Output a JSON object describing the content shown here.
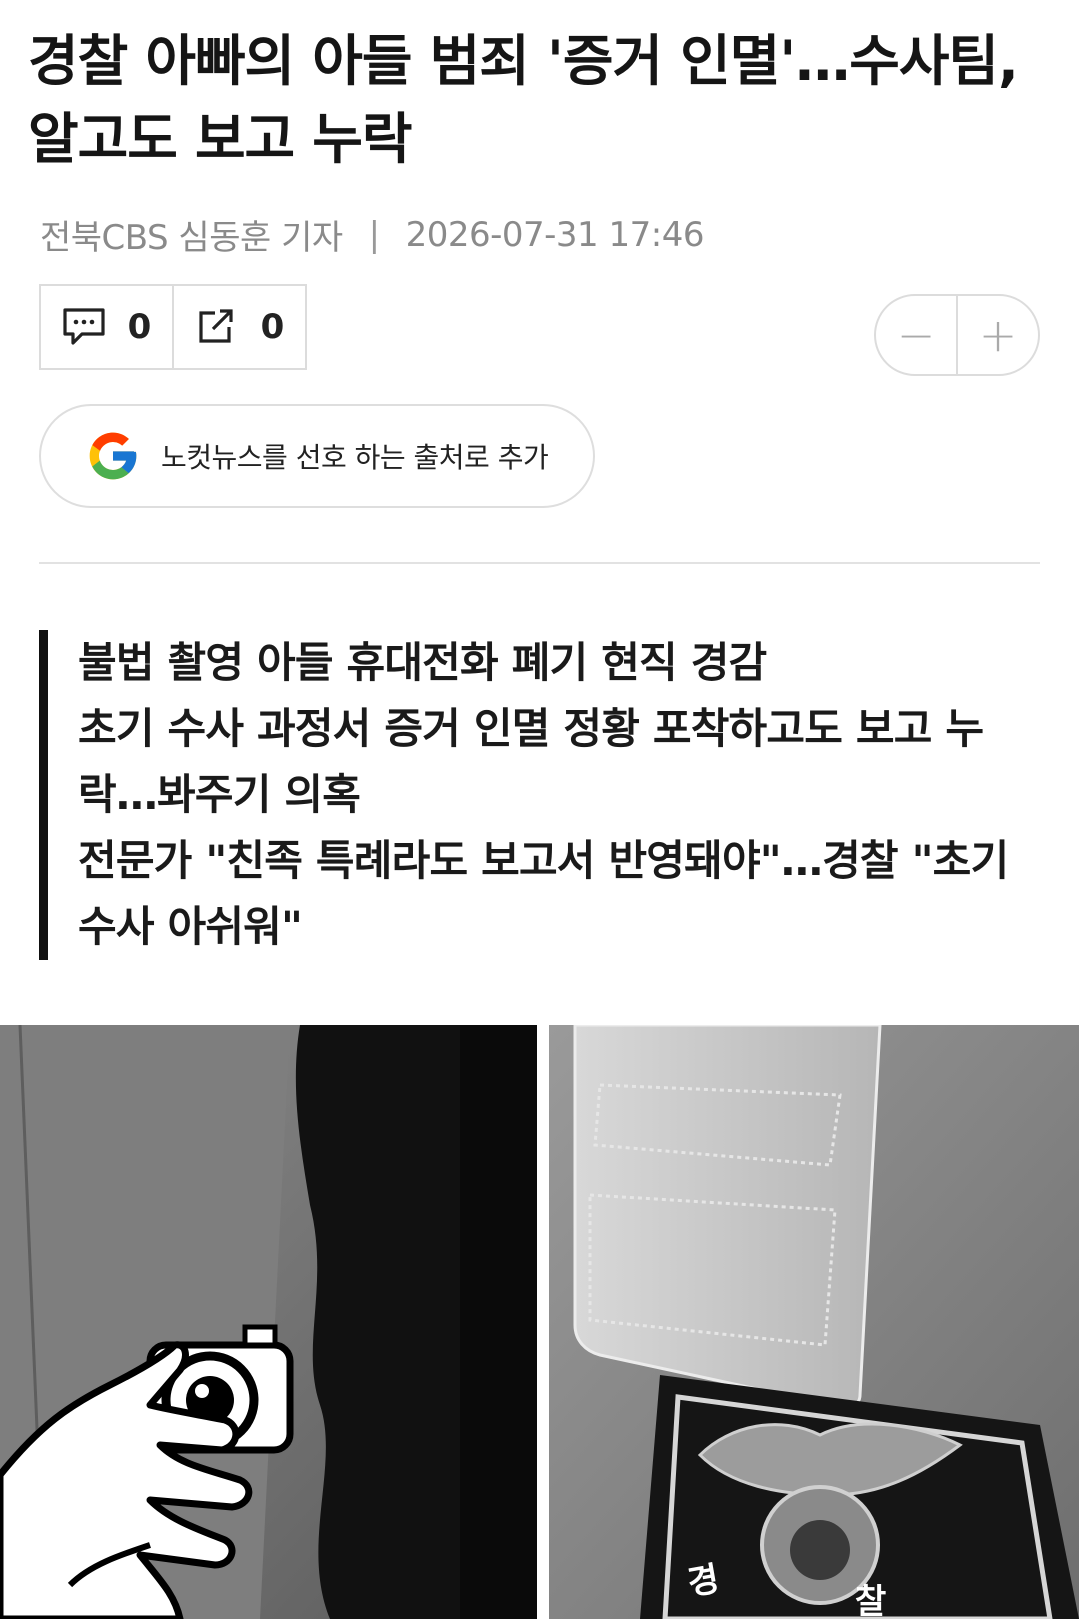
{
  "article": {
    "headline": "경찰 아빠의 아들 범죄 '증거 인멸'…수사팀, 알고도 보고 누락",
    "reporter": "전북CBS 심동훈 기자",
    "separator": "|",
    "datetime": "2026-07-31 17:46"
  },
  "actions": {
    "comment_count": "0",
    "share_count": "0",
    "zoom_out": "−",
    "zoom_in": "+"
  },
  "google_button": {
    "label": "노컷뉴스를 선호 하는 출처로 추가"
  },
  "summary": {
    "lines": [
      "불법 촬영 아들 휴대전화 폐기 현직 경감",
      "초기 수사 과정서 증거 인멸 정황 포착하고도 보고 누락…봐주기 의혹",
      "전문가 \"친족 특례라도 보고서 반영돼야\"…경찰 \"초기 수사 아쉬워\""
    ]
  },
  "photo": {
    "patch_text_1": "경",
    "patch_text_2": "찰"
  },
  "colors": {
    "text": "#151515",
    "meta": "#8a8a8a",
    "border": "#dcdcdc",
    "quote_bar": "#111111"
  }
}
